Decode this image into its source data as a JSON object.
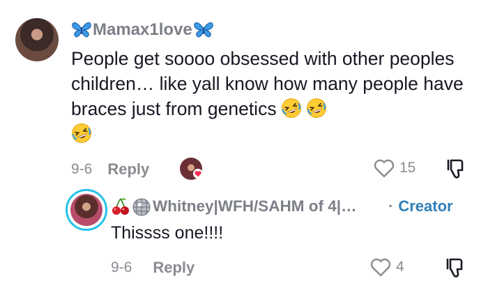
{
  "comment1": {
    "username": "Mamax1love",
    "username_decoration": "butterfly-emoji",
    "text": "People get soooo obsessed with other peoples children… like yall know how many people have braces just from genetics",
    "emojis": [
      "rolling-on-floor-laughing",
      "rolling-on-floor-laughing",
      "rolling-on-floor-laughing"
    ],
    "date": "9-6",
    "reply_label": "Reply",
    "like_count": "15"
  },
  "comment2": {
    "username": "Whitney|WFH/SAHM of 4|…",
    "username_emojis": [
      "cherries",
      "mirror-ball"
    ],
    "creator_label": "Creator",
    "creator_separator": "·",
    "text": "Thissss one!!!!",
    "date": "9-6",
    "reply_label": "Reply",
    "like_count": "4"
  },
  "colors": {
    "username": "#7c7f87",
    "text": "#161823",
    "meta": "#8a8b91",
    "creator": "#2f7fb8",
    "avatar_ring": "#25c2e8",
    "like_heart": "#fe2c55"
  }
}
